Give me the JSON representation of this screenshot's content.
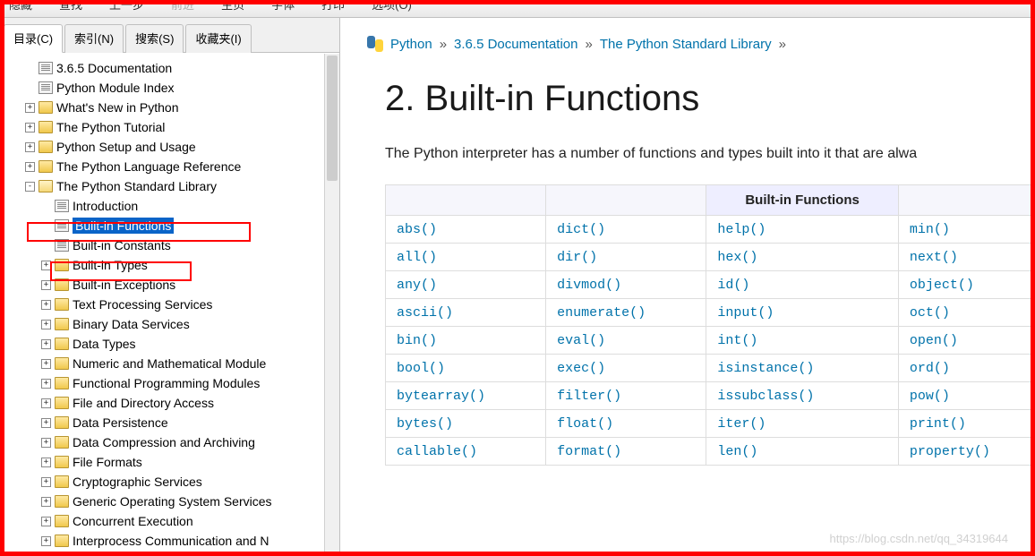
{
  "toolbar": {
    "items": [
      "隐藏",
      "查找",
      "上一步",
      "前进",
      "主页",
      "字体",
      "打印",
      "选项(O)"
    ],
    "disabled_index": 3
  },
  "sidebar": {
    "tabs": [
      {
        "label": "目录(C)",
        "active": true
      },
      {
        "label": "索引(N)",
        "active": false
      },
      {
        "label": "搜索(S)",
        "active": false
      },
      {
        "label": "收藏夹(I)",
        "active": false
      }
    ],
    "tree": [
      {
        "depth": 1,
        "exp": "",
        "icon": "doc",
        "label": "3.6.5 Documentation"
      },
      {
        "depth": 1,
        "exp": "",
        "icon": "doc",
        "label": "Python Module Index"
      },
      {
        "depth": 1,
        "exp": "+",
        "icon": "folder",
        "label": "What's New in Python"
      },
      {
        "depth": 1,
        "exp": "+",
        "icon": "folder",
        "label": "The Python Tutorial"
      },
      {
        "depth": 1,
        "exp": "+",
        "icon": "folder",
        "label": "Python Setup and Usage"
      },
      {
        "depth": 1,
        "exp": "+",
        "icon": "folder",
        "label": "The Python Language Reference"
      },
      {
        "depth": 1,
        "exp": "-",
        "icon": "folder-open",
        "label": "The Python Standard Library",
        "highlight": true
      },
      {
        "depth": 2,
        "exp": "",
        "icon": "doc",
        "label": "Introduction"
      },
      {
        "depth": 2,
        "exp": "",
        "icon": "doc",
        "label": "Built-in Functions",
        "selected": true,
        "highlight": true
      },
      {
        "depth": 2,
        "exp": "",
        "icon": "doc",
        "label": "Built-in Constants"
      },
      {
        "depth": 2,
        "exp": "+",
        "icon": "folder",
        "label": "Built-in Types"
      },
      {
        "depth": 2,
        "exp": "+",
        "icon": "folder",
        "label": "Built-in Exceptions"
      },
      {
        "depth": 2,
        "exp": "+",
        "icon": "folder",
        "label": "Text Processing Services"
      },
      {
        "depth": 2,
        "exp": "+",
        "icon": "folder",
        "label": "Binary Data Services"
      },
      {
        "depth": 2,
        "exp": "+",
        "icon": "folder",
        "label": "Data Types"
      },
      {
        "depth": 2,
        "exp": "+",
        "icon": "folder",
        "label": "Numeric and Mathematical Module"
      },
      {
        "depth": 2,
        "exp": "+",
        "icon": "folder",
        "label": "Functional Programming Modules"
      },
      {
        "depth": 2,
        "exp": "+",
        "icon": "folder",
        "label": "File and Directory Access"
      },
      {
        "depth": 2,
        "exp": "+",
        "icon": "folder",
        "label": "Data Persistence"
      },
      {
        "depth": 2,
        "exp": "+",
        "icon": "folder",
        "label": "Data Compression and Archiving"
      },
      {
        "depth": 2,
        "exp": "+",
        "icon": "folder",
        "label": "File Formats"
      },
      {
        "depth": 2,
        "exp": "+",
        "icon": "folder",
        "label": "Cryptographic Services"
      },
      {
        "depth": 2,
        "exp": "+",
        "icon": "folder",
        "label": "Generic Operating System Services"
      },
      {
        "depth": 2,
        "exp": "+",
        "icon": "folder",
        "label": "Concurrent Execution"
      },
      {
        "depth": 2,
        "exp": "+",
        "icon": "folder",
        "label": "Interprocess Communication and N"
      }
    ]
  },
  "content": {
    "breadcrumb": {
      "b1": "Python",
      "b2": "3.6.5 Documentation",
      "b3": "The Python Standard Library",
      "sep": "»"
    },
    "heading": "2. Built-in Functions",
    "intro": "The Python interpreter has a number of functions and types built into it that are alwa",
    "table_header": "Built-in Functions",
    "rows": [
      [
        "abs()",
        "dict()",
        "help()",
        "min()"
      ],
      [
        "all()",
        "dir()",
        "hex()",
        "next()"
      ],
      [
        "any()",
        "divmod()",
        "id()",
        "object()"
      ],
      [
        "ascii()",
        "enumerate()",
        "input()",
        "oct()"
      ],
      [
        "bin()",
        "eval()",
        "int()",
        "open()"
      ],
      [
        "bool()",
        "exec()",
        "isinstance()",
        "ord()"
      ],
      [
        "bytearray()",
        "filter()",
        "issubclass()",
        "pow()"
      ],
      [
        "bytes()",
        "float()",
        "iter()",
        "print()"
      ],
      [
        "callable()",
        "format()",
        "len()",
        "property()"
      ]
    ]
  },
  "watermark": "https://blog.csdn.net/qq_34319644"
}
